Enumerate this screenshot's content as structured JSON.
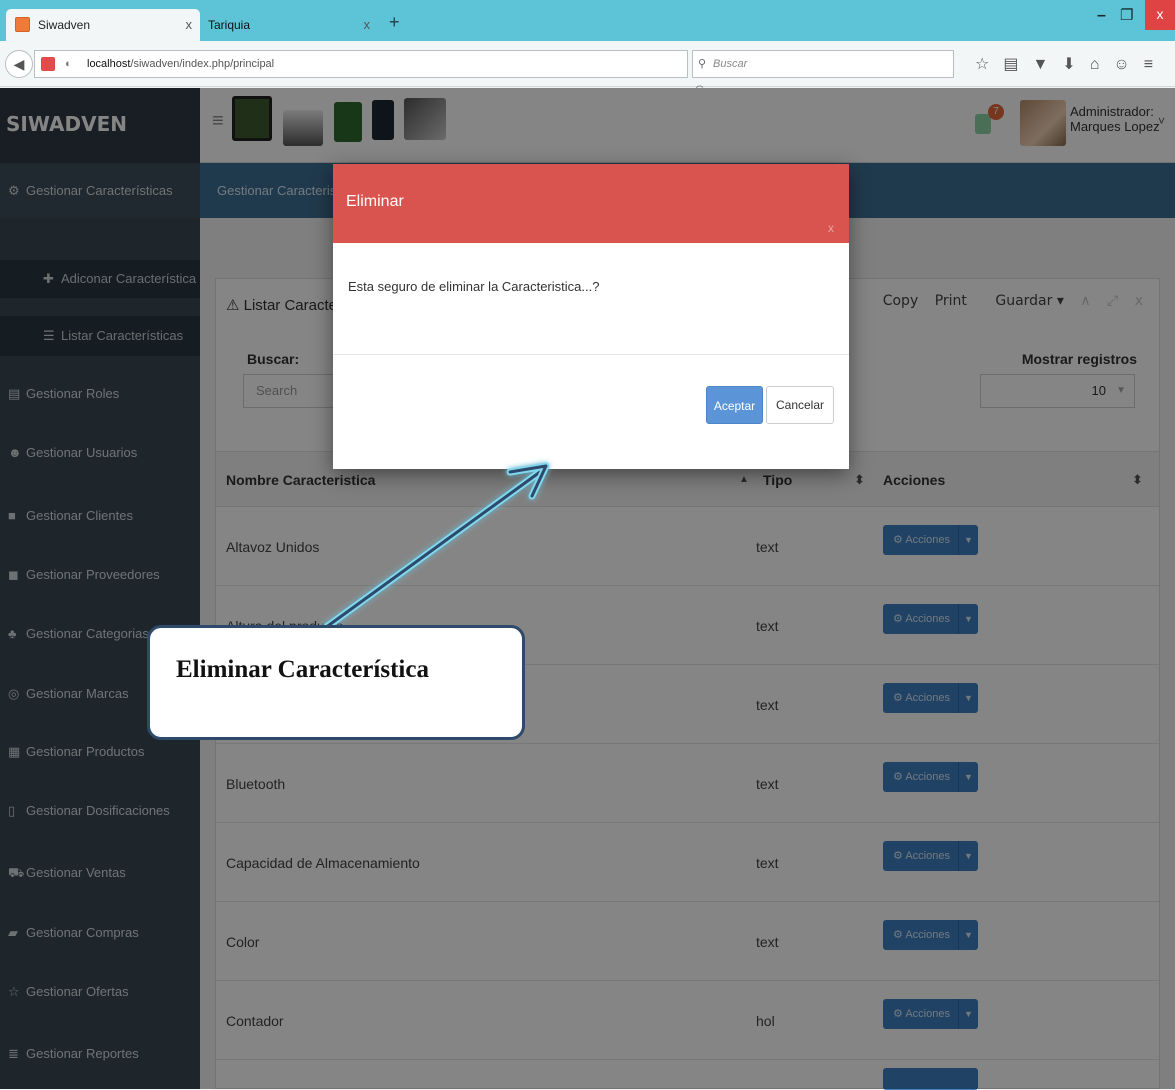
{
  "browser": {
    "tabs": [
      {
        "label": "Siwadven",
        "active": true
      },
      {
        "label": "Tariquia",
        "active": false
      }
    ],
    "url_host": "localhost",
    "url_path": "/siwadven/index.php/principal",
    "search_placeholder": "Buscar"
  },
  "app": {
    "logo": "SIWADVEN",
    "notification_count": "7",
    "user_line1": "Administrador:",
    "user_line2": "Marques Lopez"
  },
  "sidebar": {
    "items": [
      {
        "label": "Gestionar Características",
        "icon": "cogs-icon"
      },
      {
        "label": "Adiconar Característica",
        "icon": "plus-icon"
      },
      {
        "label": "Listar Características",
        "icon": "list-icon"
      },
      {
        "label": "Gestionar Roles",
        "icon": "card-icon"
      },
      {
        "label": "Gestionar Usuarios",
        "icon": "users-icon"
      },
      {
        "label": "Gestionar Clientes",
        "icon": "briefcase-icon"
      },
      {
        "label": "Gestionar Proveedores",
        "icon": "truck-icon"
      },
      {
        "label": "Gestionar Categorias",
        "icon": "sitemap-icon"
      },
      {
        "label": "Gestionar Marcas",
        "icon": "target-icon"
      },
      {
        "label": "Gestionar Productos",
        "icon": "products-icon"
      },
      {
        "label": "Gestionar Dosificaciones",
        "icon": "document-icon"
      },
      {
        "label": "Gestionar Ventas",
        "icon": "cart-icon"
      },
      {
        "label": "Gestionar Compras",
        "icon": "book-icon"
      },
      {
        "label": "Gestionar Ofertas",
        "icon": "star-icon"
      },
      {
        "label": "Gestionar Reportes",
        "icon": "report-icon"
      }
    ]
  },
  "breadcrumb": "Gestionar Caracteristicas",
  "panel": {
    "title": "Listar Caracteristicas",
    "actions": [
      "Copy",
      "Print",
      "Guardar"
    ],
    "search_label": "Buscar:",
    "search_placeholder": "Search",
    "records_label": "Mostrar registros",
    "records_value": "10"
  },
  "table": {
    "headers": [
      "Nombre Caracteristica",
      "Tipo",
      "Acciones"
    ],
    "rows": [
      {
        "name": "Altavoz Unidos",
        "type": "text"
      },
      {
        "name": "Altura del producto",
        "type": "text"
      },
      {
        "name": "",
        "type": "text"
      },
      {
        "name": "Bluetooth",
        "type": "text"
      },
      {
        "name": "Capacidad de Almacenamiento",
        "type": "text"
      },
      {
        "name": "Color",
        "type": "text"
      },
      {
        "name": "Contador",
        "type": "hol"
      }
    ],
    "action_label": "Acciones"
  },
  "modal": {
    "title": "Eliminar",
    "message": "Esta seguro de eliminar la Caracteristica...?",
    "accept": "Aceptar",
    "cancel": "Cancelar"
  },
  "callout": "Eliminar Característica",
  "colors": {
    "modal_header": "#d9534f",
    "sidebar": "#3a4a55",
    "breadcrumb": "#3f6f95",
    "primary_button": "#5b95d8"
  }
}
